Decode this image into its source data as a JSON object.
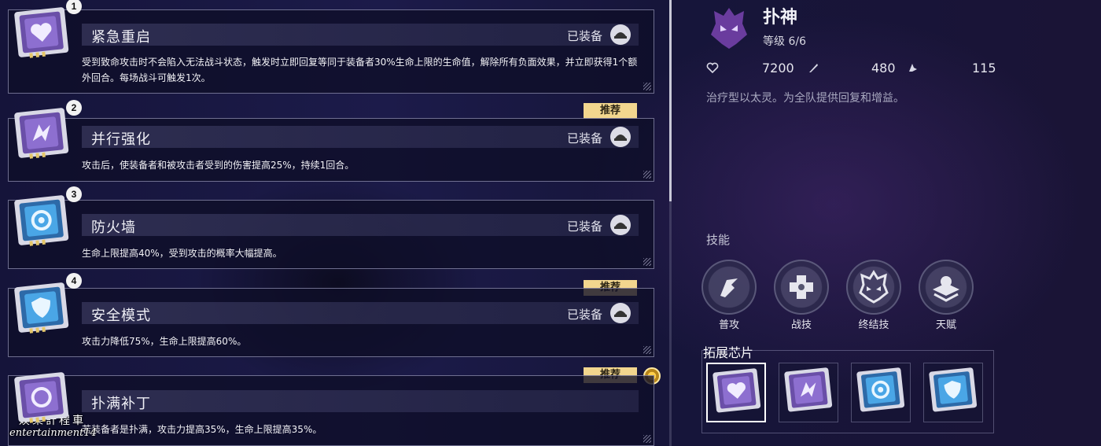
{
  "chips": [
    {
      "number": "1",
      "name": "紧急重启",
      "equipped": "已装备",
      "recommended": false,
      "description": "受到致命攻击时不会陷入无法战斗状态，触发时立即回复等同于装备者30%生命上限的生命值，解除所有负面效果，并立即获得1个额外回合。每场战斗可触发1次。",
      "icon": "heart-chip-icon",
      "color": "purple"
    },
    {
      "number": "2",
      "name": "并行强化",
      "equipped": "已装备",
      "recommended": true,
      "description": "攻击后，使装备者和被攻击者受到的伤害提高25%，持续1回合。",
      "icon": "boost-chip-icon",
      "color": "purple"
    },
    {
      "number": "3",
      "name": "防火墙",
      "equipped": "已装备",
      "recommended": false,
      "description": "生命上限提高40%，受到攻击的概率大幅提高。",
      "icon": "firewall-chip-icon",
      "color": "blue"
    },
    {
      "number": "4",
      "name": "安全模式",
      "equipped": "已装备",
      "recommended": true,
      "description": "攻击力降低75%，生命上限提高60%。",
      "icon": "shield-chip-icon",
      "color": "blue"
    },
    {
      "number": "",
      "name": "扑满补丁",
      "equipped": "",
      "recommended": true,
      "description": "若装备者是扑满，攻击力提高35%，生命上限提高35%。",
      "icon": "patch-chip-icon",
      "color": "purple"
    }
  ],
  "recommend_label": "推荐",
  "watermark": {
    "line1": "娛樂計程車",
    "line2": "entertainment14"
  },
  "character": {
    "name": "扑神",
    "level": "等级 6/6",
    "stats": {
      "hp": "7200",
      "attack": "480",
      "speed": "115"
    },
    "description": "治疗型以太灵。为全队提供回复和增益。"
  },
  "skills_title": "技能",
  "skills": [
    {
      "label": "普攻",
      "icon": "basic-attack-icon"
    },
    {
      "label": "战技",
      "icon": "heal-cross-icon"
    },
    {
      "label": "终结技",
      "icon": "ultimate-mask-icon"
    },
    {
      "label": "天赋",
      "icon": "talent-icon"
    }
  ],
  "extension_title": "拓展芯片",
  "colors": {
    "accent_gold": "#f2d68e",
    "chip_purple": "#7b5ab8",
    "chip_blue": "#3f8fd6"
  }
}
